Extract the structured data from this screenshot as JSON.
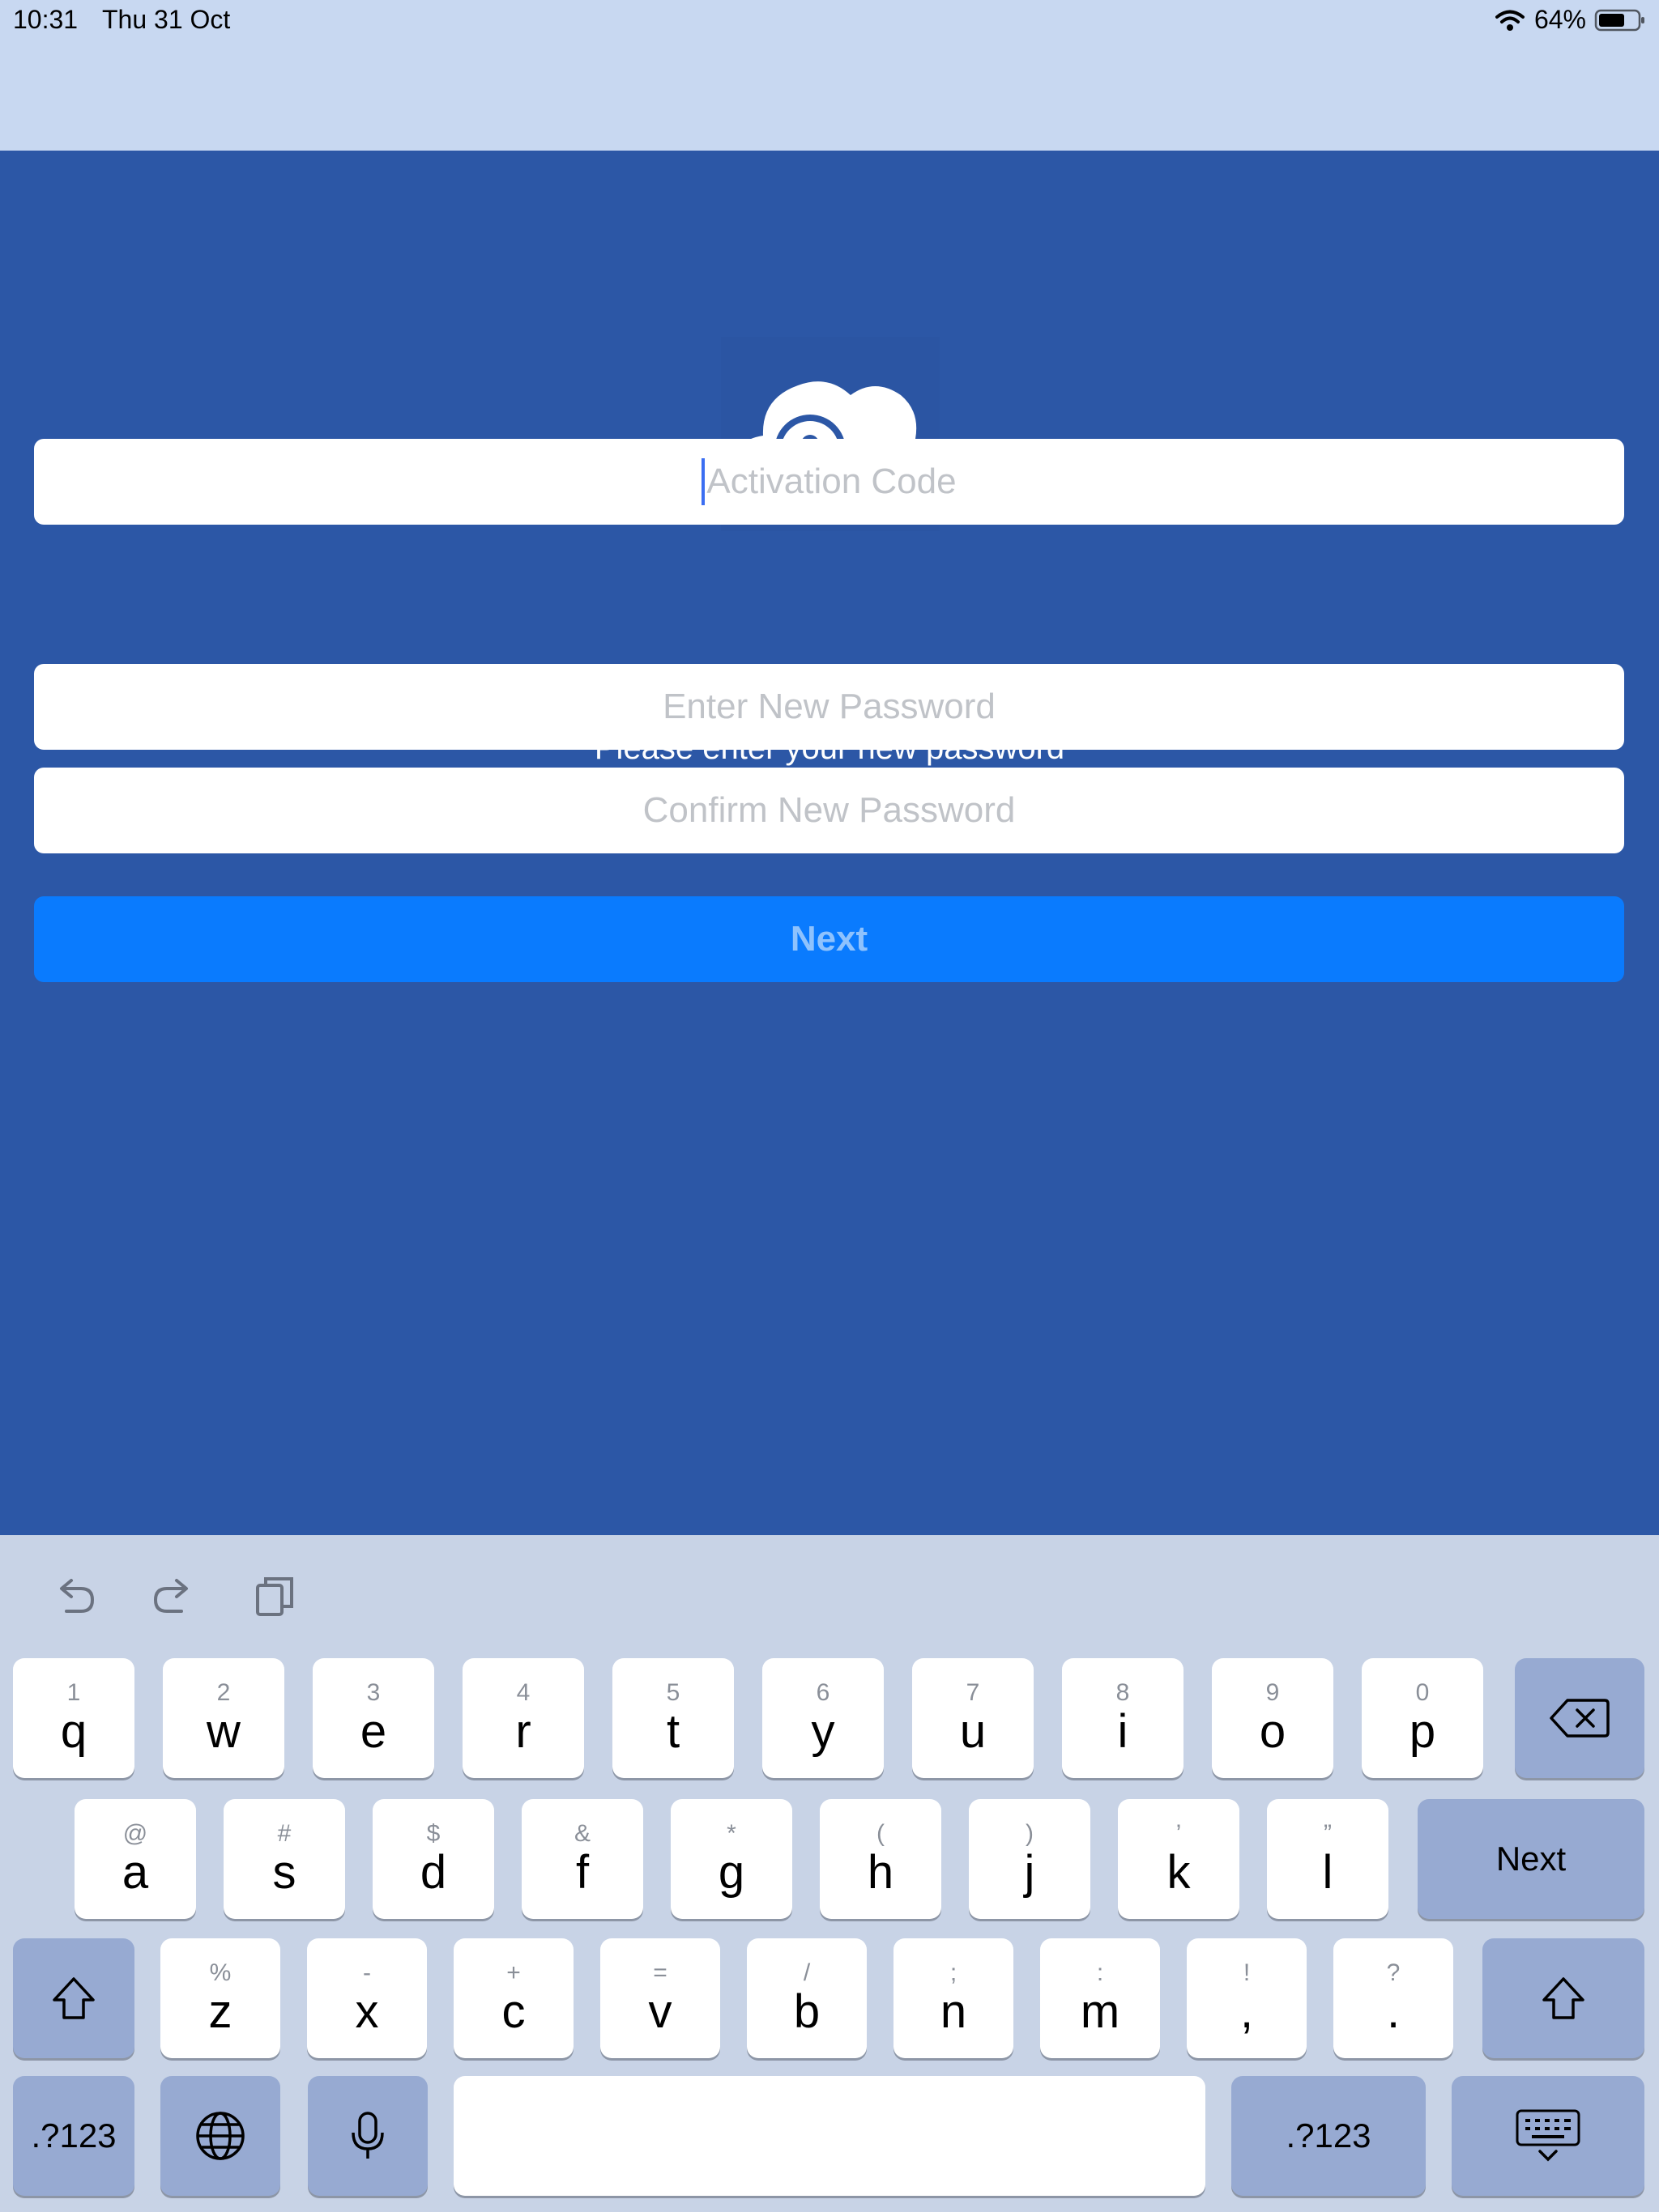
{
  "status": {
    "time": "10:31",
    "date": "Thu 31 Oct",
    "battery": "64%"
  },
  "form": {
    "activation_placeholder": "Activation Code",
    "prompt": "Please enter your new password",
    "new_password_placeholder": "Enter New Password",
    "confirm_password_placeholder": "Confirm New Password",
    "next_label": "Next"
  },
  "keyboard": {
    "row1": [
      {
        "sub": "1",
        "ch": "q"
      },
      {
        "sub": "2",
        "ch": "w"
      },
      {
        "sub": "3",
        "ch": "e"
      },
      {
        "sub": "4",
        "ch": "r"
      },
      {
        "sub": "5",
        "ch": "t"
      },
      {
        "sub": "6",
        "ch": "y"
      },
      {
        "sub": "7",
        "ch": "u"
      },
      {
        "sub": "8",
        "ch": "i"
      },
      {
        "sub": "9",
        "ch": "o"
      },
      {
        "sub": "0",
        "ch": "p"
      }
    ],
    "row2": [
      {
        "sub": "@",
        "ch": "a"
      },
      {
        "sub": "#",
        "ch": "s"
      },
      {
        "sub": "$",
        "ch": "d"
      },
      {
        "sub": "&",
        "ch": "f"
      },
      {
        "sub": "*",
        "ch": "g"
      },
      {
        "sub": "(",
        "ch": "h"
      },
      {
        "sub": ")",
        "ch": "j"
      },
      {
        "sub": "’",
        "ch": "k"
      },
      {
        "sub": "”",
        "ch": "l"
      }
    ],
    "row3": [
      {
        "sub": "%",
        "ch": "z"
      },
      {
        "sub": "-",
        "ch": "x"
      },
      {
        "sub": "+",
        "ch": "c"
      },
      {
        "sub": "=",
        "ch": "v"
      },
      {
        "sub": "/",
        "ch": "b"
      },
      {
        "sub": ";",
        "ch": "n"
      },
      {
        "sub": ":",
        "ch": "m"
      },
      {
        "sub": "!",
        "ch": ","
      },
      {
        "sub": "?",
        "ch": "."
      }
    ],
    "return_label": "Next",
    "numbers_label": ".?123",
    "numbers_label_right": ".?123"
  },
  "colors": {
    "brand_blue": "#2c57a6",
    "button_blue": "#0a7bfe",
    "top_strip": "#c8d8f1"
  },
  "icons": [
    "cloud-chat-logo-icon",
    "wifi-icon",
    "battery-icon",
    "undo-icon",
    "redo-icon",
    "clipboard-icon",
    "backspace-icon",
    "shift-icon",
    "globe-icon",
    "microphone-icon",
    "keyboard-dismiss-icon"
  ]
}
